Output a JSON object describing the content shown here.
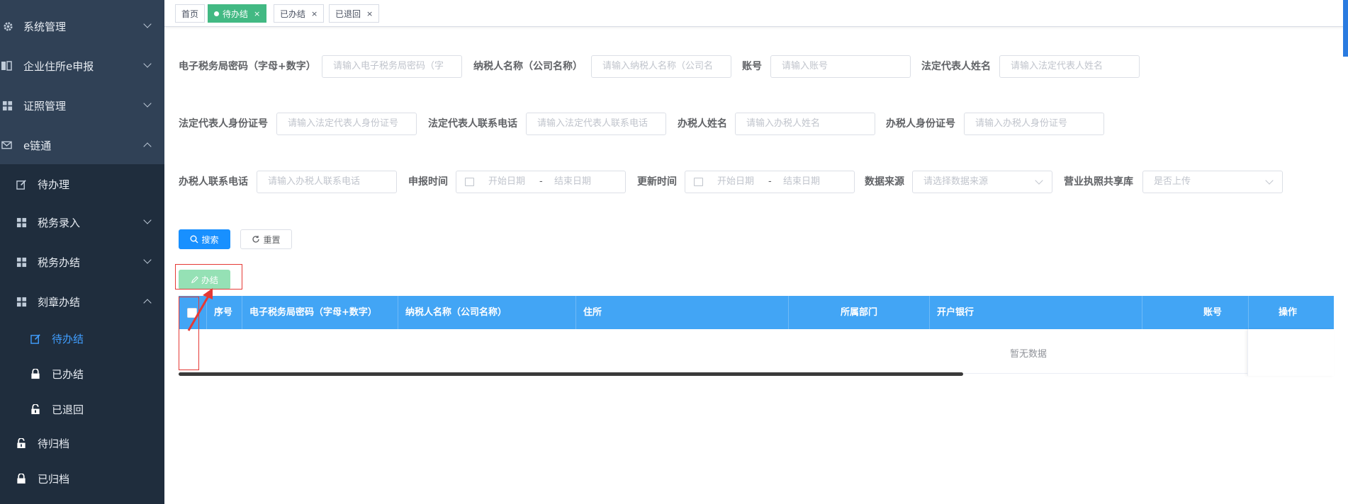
{
  "sidebar": {
    "items": [
      {
        "label": "系统管理",
        "icon": "gear-icon"
      },
      {
        "label": "企业住所e申报",
        "icon": "book-icon"
      },
      {
        "label": "证照管理",
        "icon": "grid-icon"
      },
      {
        "label": "e链通",
        "icon": "mail-icon"
      },
      {
        "label": "待办理",
        "icon": "edit-icon"
      },
      {
        "label": "税务录入",
        "icon": "grid-icon"
      },
      {
        "label": "税务办结",
        "icon": "grid-icon"
      },
      {
        "label": "刻章办结",
        "icon": "grid-icon"
      },
      {
        "label": "待办结",
        "icon": "edit-icon"
      },
      {
        "label": "已办结",
        "icon": "lock-icon"
      },
      {
        "label": "已退回",
        "icon": "unlock-icon"
      },
      {
        "label": "待归档",
        "icon": "unlock-icon"
      },
      {
        "label": "已归档",
        "icon": "lock-icon"
      }
    ]
  },
  "tags": [
    {
      "label": "首页"
    },
    {
      "label": "待办结",
      "close": "×"
    },
    {
      "label": "已办结",
      "close": "×"
    },
    {
      "label": "已退回",
      "close": "×"
    }
  ],
  "filters": {
    "row1": [
      {
        "label": "电子税务局密码（字母+数字）",
        "placeholder": "请输入电子税务局密码（字"
      },
      {
        "label": "纳税人名称（公司名称）",
        "placeholder": "请输入纳税人名称（公司名"
      },
      {
        "label": "账号",
        "placeholder": "请输入账号"
      },
      {
        "label": "法定代表人姓名",
        "placeholder": "请输入法定代表人姓名"
      }
    ],
    "row2": [
      {
        "label": "法定代表人身份证号",
        "placeholder": "请输入法定代表人身份证号"
      },
      {
        "label": "法定代表人联系电话",
        "placeholder": "请输入法定代表人联系电话"
      },
      {
        "label": "办税人姓名",
        "placeholder": "请输入办税人姓名"
      },
      {
        "label": "办税人身份证号",
        "placeholder": "请输入办税人身份证号"
      }
    ],
    "row3": [
      {
        "label": "办税人联系电话",
        "placeholder": "请输入办税人联系电话"
      },
      {
        "label": "申报时间",
        "start": "开始日期",
        "sep": "-",
        "end": "结束日期"
      },
      {
        "label": "更新时间",
        "start": "开始日期",
        "sep": "-",
        "end": "结束日期"
      },
      {
        "label": "数据来源",
        "placeholder": "请选择数据来源"
      },
      {
        "label": "营业执照共享库",
        "placeholder": "是否上传"
      }
    ]
  },
  "buttons": {
    "search": "搜索",
    "reset": "重置",
    "complete": "办结"
  },
  "table": {
    "columns": [
      "序号",
      "电子税务局密码（字母+数字）",
      "纳税人名称（公司名称）",
      "住所",
      "所属部门",
      "开户银行",
      "账号",
      "操作"
    ],
    "empty_text": "暂无数据"
  },
  "colors": {
    "sidebar_bg": "#304156",
    "header_bg": "#42a5f5",
    "primary": "#1890ff",
    "success": "#42b983",
    "annotation": "#e53935"
  }
}
